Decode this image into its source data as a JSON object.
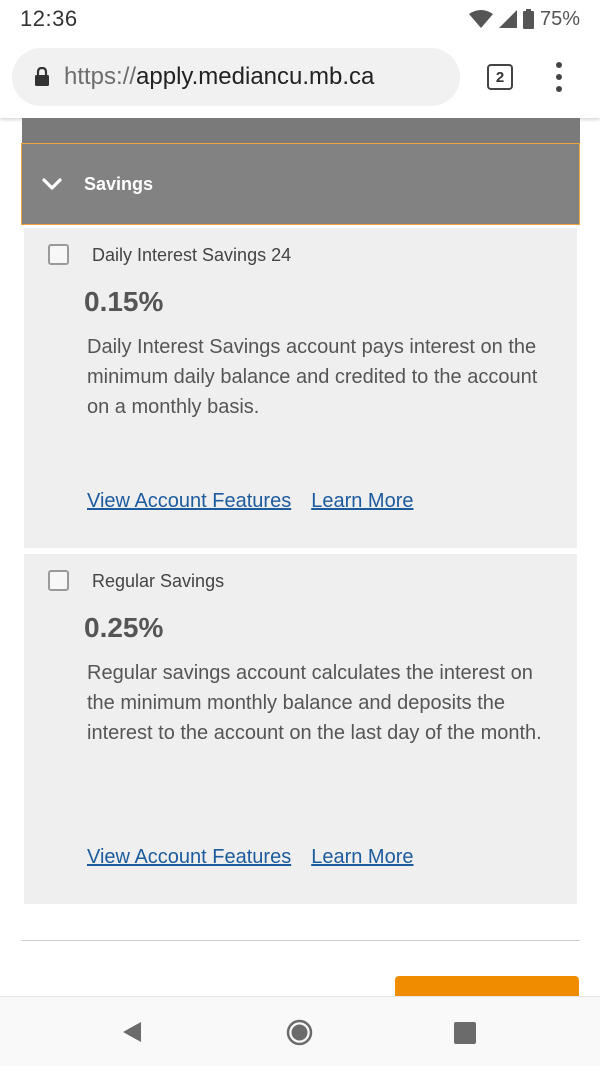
{
  "status_bar": {
    "time": "12:36",
    "battery": "75%",
    "icons": [
      "wifi-icon",
      "cell-signal-icon",
      "battery-icon"
    ]
  },
  "browser": {
    "url_scheme": "https://",
    "url_host": "apply.mediancu.mb.ca",
    "tab_count": "2"
  },
  "section": {
    "title": "Savings"
  },
  "accounts": [
    {
      "name": "Daily Interest Savings 24",
      "rate": "0.15%",
      "description": "Daily Interest Savings account pays interest on the minimum daily balance and credited to the account on a monthly basis.",
      "features_link": "View Account Features",
      "learn_link": "Learn More"
    },
    {
      "name": "Regular Savings",
      "rate": "0.25%",
      "description": "Regular savings account calculates the interest on the minimum monthly balance and deposits the interest to the account on the last day of the month.",
      "features_link": "View Account Features",
      "learn_link": "Learn More"
    }
  ],
  "colors": {
    "header_bg": "#828282",
    "header_border": "#f0a53a",
    "card_bg": "#efefef",
    "link": "#1c5b9e",
    "button": "#f08c00"
  }
}
